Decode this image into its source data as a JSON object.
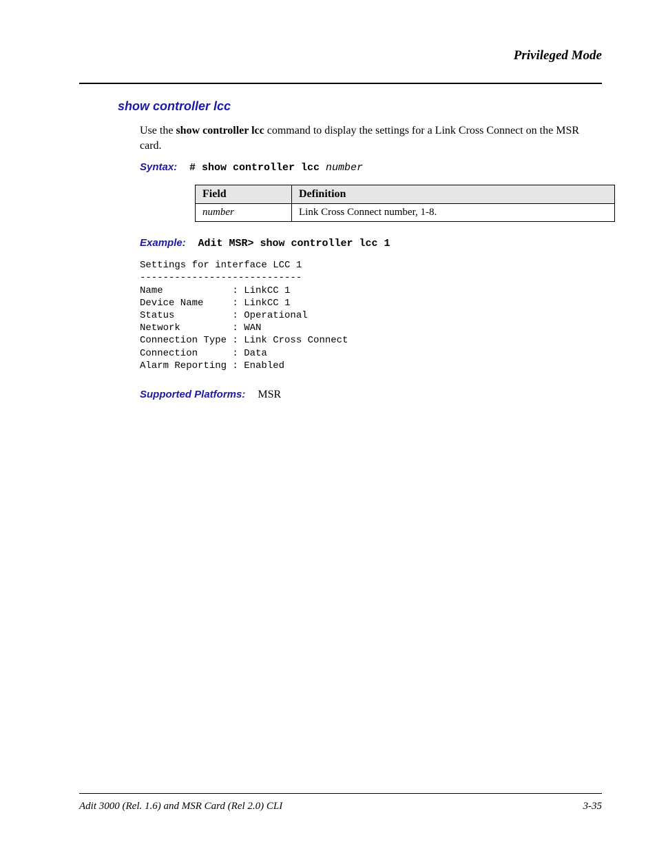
{
  "header": "Privileged Mode",
  "section_title": "show controller lcc",
  "body": {
    "pre_cmd": "Use the ",
    "cmd": "show controller lcc",
    "post_cmd": " command to display the settings for a Link Cross Connect on the MSR card."
  },
  "syntax": {
    "label": "Syntax:",
    "prompt": "# show controller lcc ",
    "arg": "number"
  },
  "table": {
    "headers": [
      "Field",
      "Definition"
    ],
    "rows": [
      {
        "field": "number",
        "definition": "Link Cross Connect number, 1-8."
      }
    ]
  },
  "example": {
    "label": "Example:",
    "command": "Adit MSR> show controller lcc 1"
  },
  "output": "Settings for interface LCC 1\n----------------------------\nName            : LinkCC 1\nDevice Name     : LinkCC 1\nStatus          : Operational\nNetwork         : WAN\nConnection Type : Link Cross Connect\nConnection      : Data\nAlarm Reporting : Enabled",
  "supported": {
    "label": "Supported Platforms:",
    "value": "  MSR"
  },
  "footer": {
    "left": "Adit 3000 (Rel. 1.6) and MSR Card (Rel 2.0) CLI",
    "right": "3-35"
  }
}
